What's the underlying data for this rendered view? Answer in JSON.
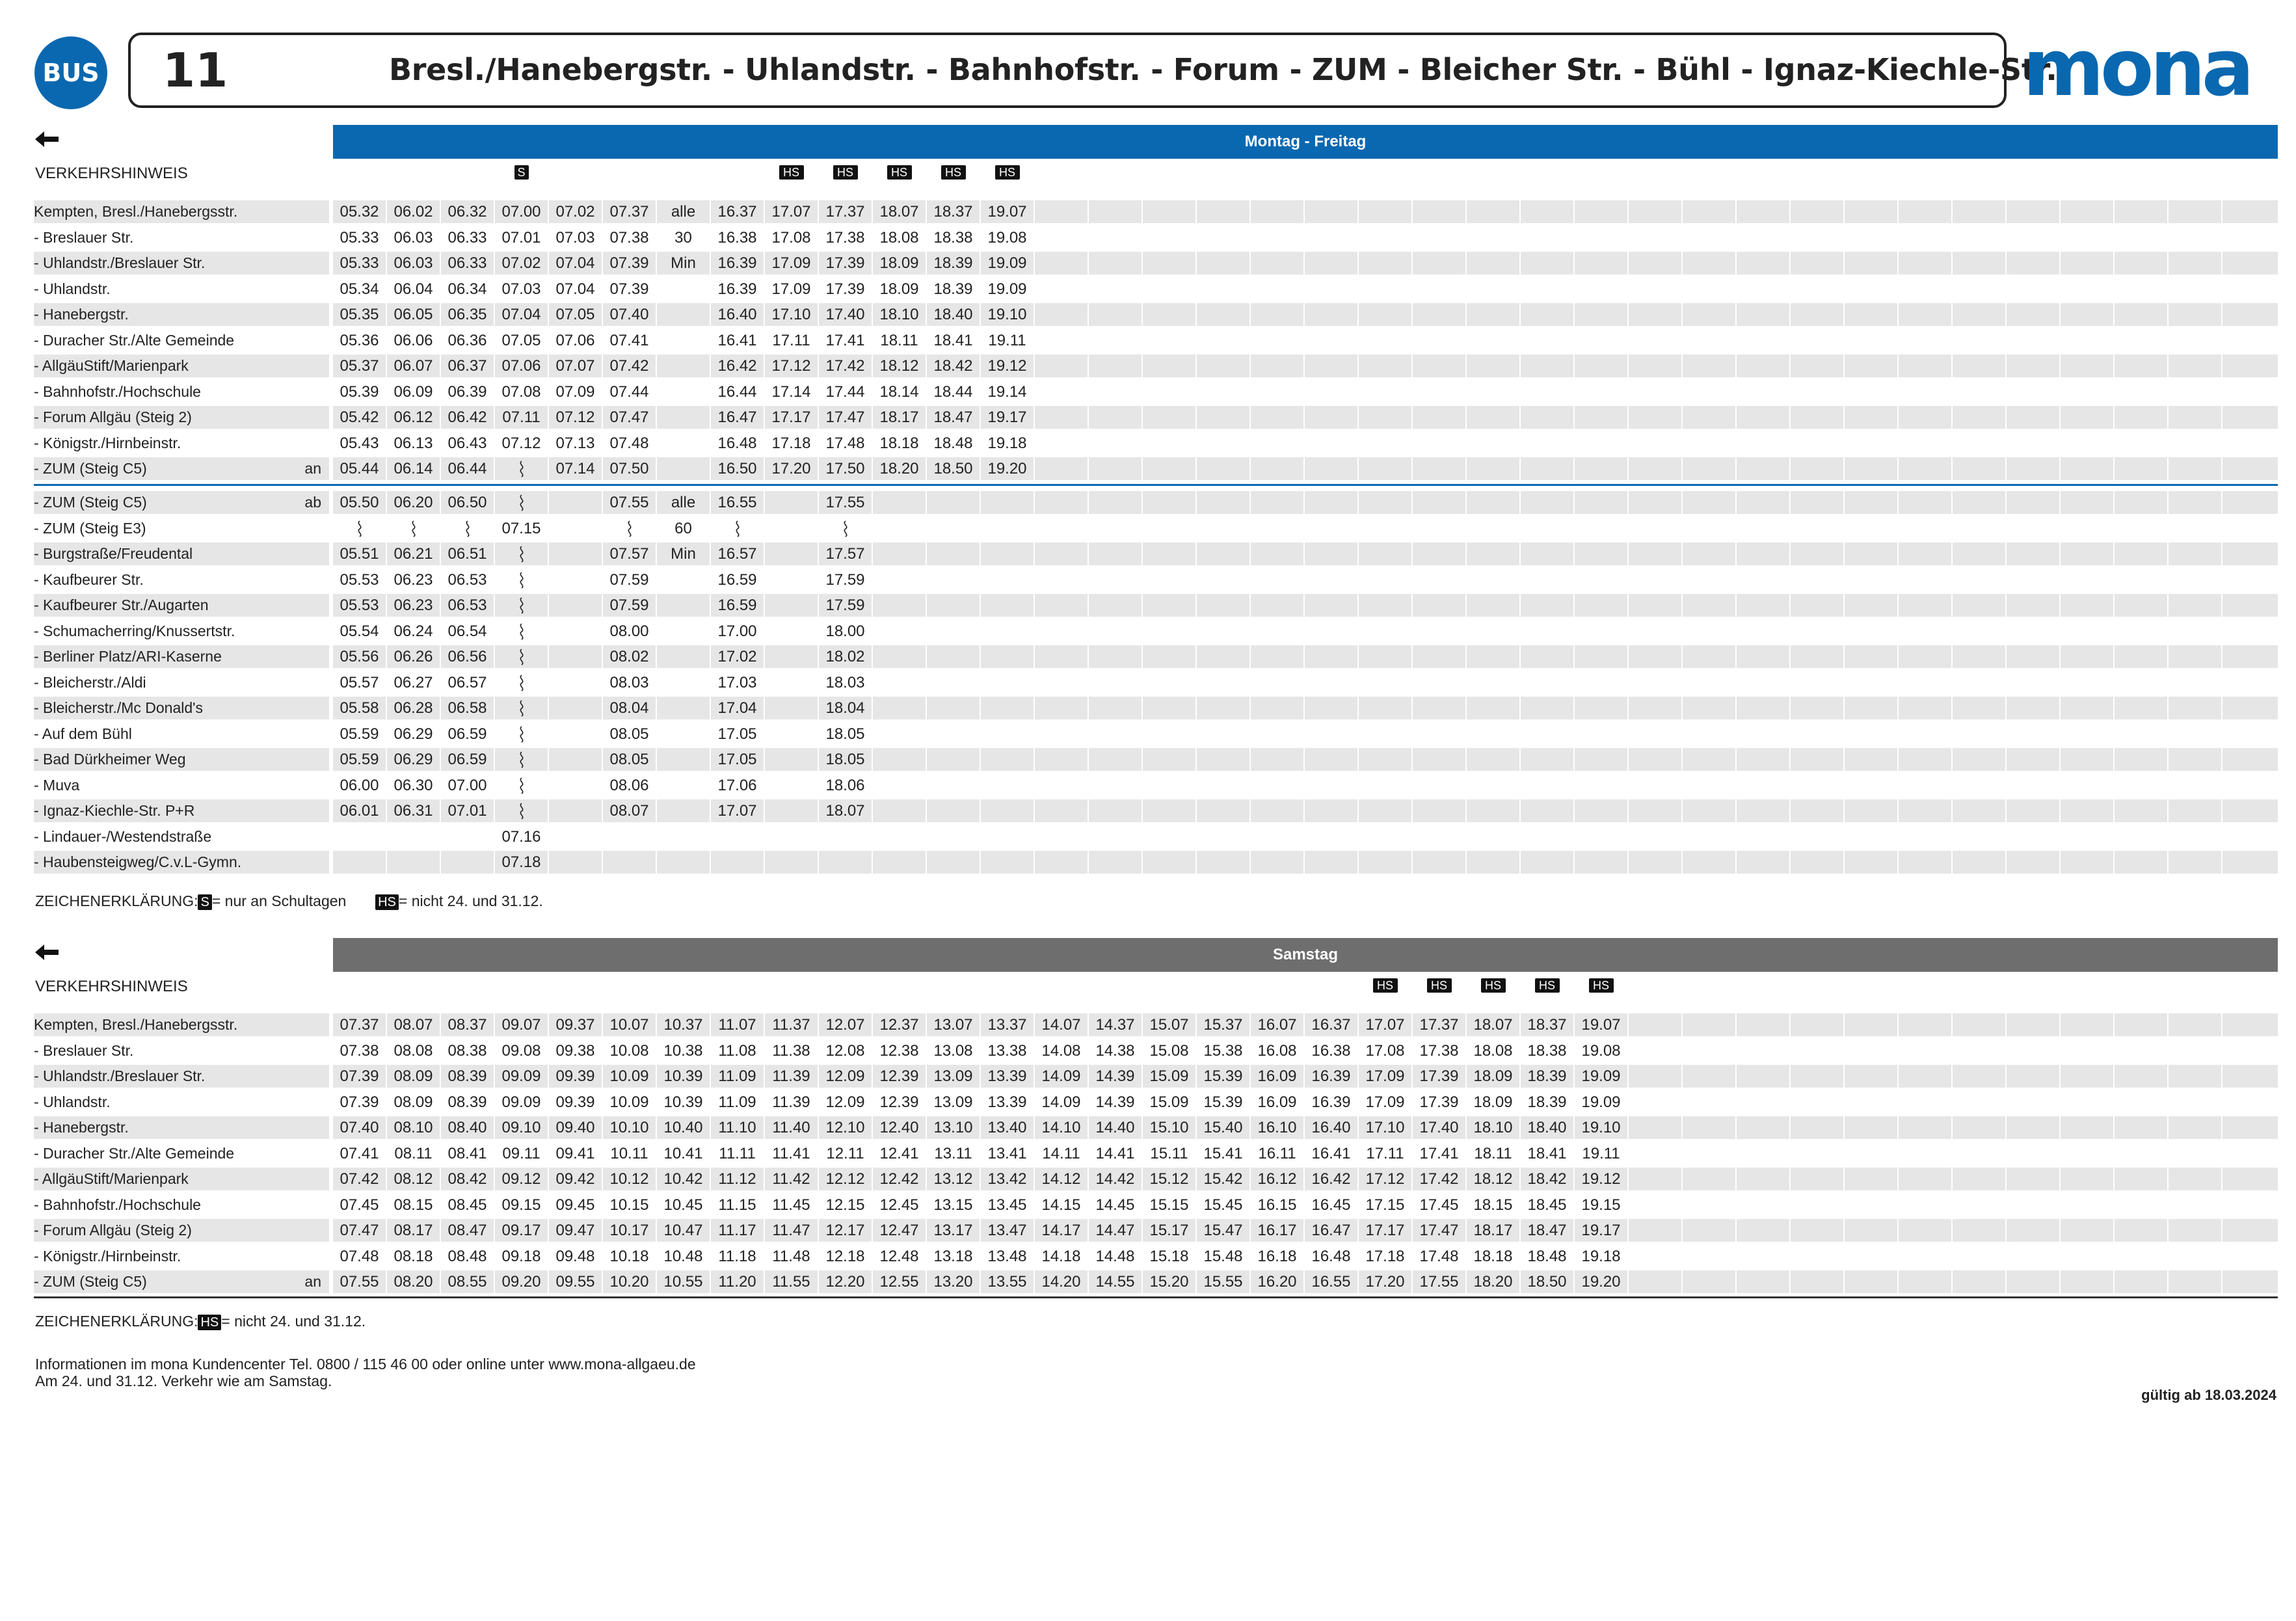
{
  "header": {
    "bus_label": "BUS",
    "line_number": "11",
    "route_title": "Bresl./Hanebergstr. - Uhlandstr. - Bahnhofstr. - Forum - ZUM - Bleicher Str. - Bühl  - Ignaz-Kiechle-Str.",
    "brand": "mona",
    "brand_color": "#0a68b0"
  },
  "weekday": {
    "day_label": "Montag - Freitag",
    "bar_color": "#0a68b0",
    "hinweis_label": "VERKEHRSHINWEIS",
    "markers": [
      "",
      "",
      "",
      "S",
      "",
      "",
      "",
      "",
      "HS",
      "HS",
      "HS",
      "HS",
      "HS"
    ],
    "part1": {
      "stops": [
        {
          "name": "Kempten, Bresl./Hanebergsstr.",
          "times": [
            "05.32",
            "06.02",
            "06.32",
            "07.00",
            "07.02",
            "07.37",
            "alle",
            "16.37",
            "17.07",
            "17.37",
            "18.07",
            "18.37",
            "19.07"
          ]
        },
        {
          "name": "- Breslauer Str.",
          "times": [
            "05.33",
            "06.03",
            "06.33",
            "07.01",
            "07.03",
            "07.38",
            "30",
            "16.38",
            "17.08",
            "17.38",
            "18.08",
            "18.38",
            "19.08"
          ]
        },
        {
          "name": "- Uhlandstr./Breslauer Str.",
          "times": [
            "05.33",
            "06.03",
            "06.33",
            "07.02",
            "07.04",
            "07.39",
            "Min",
            "16.39",
            "17.09",
            "17.39",
            "18.09",
            "18.39",
            "19.09"
          ]
        },
        {
          "name": "- Uhlandstr.",
          "times": [
            "05.34",
            "06.04",
            "06.34",
            "07.03",
            "07.04",
            "07.39",
            "",
            "16.39",
            "17.09",
            "17.39",
            "18.09",
            "18.39",
            "19.09"
          ]
        },
        {
          "name": "- Hanebergstr.",
          "times": [
            "05.35",
            "06.05",
            "06.35",
            "07.04",
            "07.05",
            "07.40",
            "",
            "16.40",
            "17.10",
            "17.40",
            "18.10",
            "18.40",
            "19.10"
          ]
        },
        {
          "name": "- Duracher Str./Alte Gemeinde",
          "times": [
            "05.36",
            "06.06",
            "06.36",
            "07.05",
            "07.06",
            "07.41",
            "",
            "16.41",
            "17.11",
            "17.41",
            "18.11",
            "18.41",
            "19.11"
          ]
        },
        {
          "name": "- AllgäuStift/Marienpark",
          "times": [
            "05.37",
            "06.07",
            "06.37",
            "07.06",
            "07.07",
            "07.42",
            "",
            "16.42",
            "17.12",
            "17.42",
            "18.12",
            "18.42",
            "19.12"
          ]
        },
        {
          "name": "- Bahnhofstr./Hochschule",
          "times": [
            "05.39",
            "06.09",
            "06.39",
            "07.08",
            "07.09",
            "07.44",
            "",
            "16.44",
            "17.14",
            "17.44",
            "18.14",
            "18.44",
            "19.14"
          ]
        },
        {
          "name": "- Forum Allgäu (Steig 2)",
          "times": [
            "05.42",
            "06.12",
            "06.42",
            "07.11",
            "07.12",
            "07.47",
            "",
            "16.47",
            "17.17",
            "17.47",
            "18.17",
            "18.47",
            "19.17"
          ]
        },
        {
          "name": "- Königstr./Hirnbeinstr.",
          "times": [
            "05.43",
            "06.13",
            "06.43",
            "07.12",
            "07.13",
            "07.48",
            "",
            "16.48",
            "17.18",
            "17.48",
            "18.18",
            "18.48",
            "19.18"
          ]
        },
        {
          "name": "- ZUM (Steig C5)",
          "anab": "an",
          "times": [
            "05.44",
            "06.14",
            "06.44",
            "~",
            "07.14",
            "07.50",
            "",
            "16.50",
            "17.20",
            "17.50",
            "18.20",
            "18.50",
            "19.20"
          ]
        }
      ]
    },
    "part2": {
      "stops": [
        {
          "name": "- ZUM (Steig C5)",
          "anab": "ab",
          "times": [
            "05.50",
            "06.20",
            "06.50",
            "~",
            "",
            "07.55",
            "alle",
            "16.55",
            "",
            "17.55"
          ]
        },
        {
          "name": "- ZUM (Steig E3)",
          "times": [
            "~",
            "~",
            "~",
            "07.15",
            "",
            "~",
            "60",
            "~",
            "",
            "~"
          ]
        },
        {
          "name": "- Burgstraße/Freudental",
          "times": [
            "05.51",
            "06.21",
            "06.51",
            "~",
            "",
            "07.57",
            "Min",
            "16.57",
            "",
            "17.57"
          ]
        },
        {
          "name": "- Kaufbeurer Str.",
          "times": [
            "05.53",
            "06.23",
            "06.53",
            "~",
            "",
            "07.59",
            "",
            "16.59",
            "",
            "17.59"
          ]
        },
        {
          "name": "- Kaufbeurer Str./Augarten",
          "times": [
            "05.53",
            "06.23",
            "06.53",
            "~",
            "",
            "07.59",
            "",
            "16.59",
            "",
            "17.59"
          ]
        },
        {
          "name": "- Schumacherring/Knussertstr.",
          "times": [
            "05.54",
            "06.24",
            "06.54",
            "~",
            "",
            "08.00",
            "",
            "17.00",
            "",
            "18.00"
          ]
        },
        {
          "name": "- Berliner Platz/ARI-Kaserne",
          "times": [
            "05.56",
            "06.26",
            "06.56",
            "~",
            "",
            "08.02",
            "",
            "17.02",
            "",
            "18.02"
          ]
        },
        {
          "name": "- Bleicherstr./Aldi",
          "times": [
            "05.57",
            "06.27",
            "06.57",
            "~",
            "",
            "08.03",
            "",
            "17.03",
            "",
            "18.03"
          ]
        },
        {
          "name": "- Bleicherstr./Mc Donald's",
          "times": [
            "05.58",
            "06.28",
            "06.58",
            "~",
            "",
            "08.04",
            "",
            "17.04",
            "",
            "18.04"
          ]
        },
        {
          "name": "- Auf dem Bühl",
          "times": [
            "05.59",
            "06.29",
            "06.59",
            "~",
            "",
            "08.05",
            "",
            "17.05",
            "",
            "18.05"
          ]
        },
        {
          "name": "- Bad Dürkheimer Weg",
          "times": [
            "05.59",
            "06.29",
            "06.59",
            "~",
            "",
            "08.05",
            "",
            "17.05",
            "",
            "18.05"
          ]
        },
        {
          "name": "- Muva",
          "times": [
            "06.00",
            "06.30",
            "07.00",
            "~",
            "",
            "08.06",
            "",
            "17.06",
            "",
            "18.06"
          ]
        },
        {
          "name": "- Ignaz-Kiechle-Str. P+R",
          "times": [
            "06.01",
            "06.31",
            "07.01",
            "~",
            "",
            "08.07",
            "",
            "17.07",
            "",
            "18.07"
          ]
        },
        {
          "name": "- Lindauer-/Westendstraße",
          "times": [
            "",
            "",
            "",
            "07.16"
          ]
        },
        {
          "name": "- Haubensteigweg/C.v.L-Gymn.",
          "times": [
            "",
            "",
            "",
            "07.18"
          ]
        }
      ]
    },
    "legend": {
      "prefix": "ZEICHENERKLÄRUNG:",
      "s_tag": "S",
      "s_text": "= nur an Schultagen",
      "hs_tag": "HS",
      "hs_text": "= nicht 24. und 31.12."
    }
  },
  "saturday": {
    "day_label": "Samstag",
    "bar_color": "#6e6e6e",
    "hinweis_label": "VERKEHRSHINWEIS",
    "markers": [
      "",
      "",
      "",
      "",
      "",
      "",
      "",
      "",
      "",
      "",
      "",
      "",
      "",
      "",
      "",
      "",
      "",
      "",
      "",
      "HS",
      "HS",
      "HS",
      "HS",
      "HS"
    ],
    "stops": [
      {
        "name": "Kempten, Bresl./Hanebergsstr.",
        "times": [
          "07.37",
          "08.07",
          "08.37",
          "09.07",
          "09.37",
          "10.07",
          "10.37",
          "11.07",
          "11.37",
          "12.07",
          "12.37",
          "13.07",
          "13.37",
          "14.07",
          "14.37",
          "15.07",
          "15.37",
          "16.07",
          "16.37",
          "17.07",
          "17.37",
          "18.07",
          "18.37",
          "19.07"
        ]
      },
      {
        "name": "- Breslauer Str.",
        "times": [
          "07.38",
          "08.08",
          "08.38",
          "09.08",
          "09.38",
          "10.08",
          "10.38",
          "11.08",
          "11.38",
          "12.08",
          "12.38",
          "13.08",
          "13.38",
          "14.08",
          "14.38",
          "15.08",
          "15.38",
          "16.08",
          "16.38",
          "17.08",
          "17.38",
          "18.08",
          "18.38",
          "19.08"
        ]
      },
      {
        "name": "- Uhlandstr./Breslauer Str.",
        "times": [
          "07.39",
          "08.09",
          "08.39",
          "09.09",
          "09.39",
          "10.09",
          "10.39",
          "11.09",
          "11.39",
          "12.09",
          "12.39",
          "13.09",
          "13.39",
          "14.09",
          "14.39",
          "15.09",
          "15.39",
          "16.09",
          "16.39",
          "17.09",
          "17.39",
          "18.09",
          "18.39",
          "19.09"
        ]
      },
      {
        "name": "- Uhlandstr.",
        "times": [
          "07.39",
          "08.09",
          "08.39",
          "09.09",
          "09.39",
          "10.09",
          "10.39",
          "11.09",
          "11.39",
          "12.09",
          "12.39",
          "13.09",
          "13.39",
          "14.09",
          "14.39",
          "15.09",
          "15.39",
          "16.09",
          "16.39",
          "17.09",
          "17.39",
          "18.09",
          "18.39",
          "19.09"
        ]
      },
      {
        "name": "- Hanebergstr.",
        "times": [
          "07.40",
          "08.10",
          "08.40",
          "09.10",
          "09.40",
          "10.10",
          "10.40",
          "11.10",
          "11.40",
          "12.10",
          "12.40",
          "13.10",
          "13.40",
          "14.10",
          "14.40",
          "15.10",
          "15.40",
          "16.10",
          "16.40",
          "17.10",
          "17.40",
          "18.10",
          "18.40",
          "19.10"
        ]
      },
      {
        "name": "- Duracher Str./Alte Gemeinde",
        "times": [
          "07.41",
          "08.11",
          "08.41",
          "09.11",
          "09.41",
          "10.11",
          "10.41",
          "11.11",
          "11.41",
          "12.11",
          "12.41",
          "13.11",
          "13.41",
          "14.11",
          "14.41",
          "15.11",
          "15.41",
          "16.11",
          "16.41",
          "17.11",
          "17.41",
          "18.11",
          "18.41",
          "19.11"
        ]
      },
      {
        "name": "- AllgäuStift/Marienpark",
        "times": [
          "07.42",
          "08.12",
          "08.42",
          "09.12",
          "09.42",
          "10.12",
          "10.42",
          "11.12",
          "11.42",
          "12.12",
          "12.42",
          "13.12",
          "13.42",
          "14.12",
          "14.42",
          "15.12",
          "15.42",
          "16.12",
          "16.42",
          "17.12",
          "17.42",
          "18.12",
          "18.42",
          "19.12"
        ]
      },
      {
        "name": "- Bahnhofstr./Hochschule",
        "times": [
          "07.45",
          "08.15",
          "08.45",
          "09.15",
          "09.45",
          "10.15",
          "10.45",
          "11.15",
          "11.45",
          "12.15",
          "12.45",
          "13.15",
          "13.45",
          "14.15",
          "14.45",
          "15.15",
          "15.45",
          "16.15",
          "16.45",
          "17.15",
          "17.45",
          "18.15",
          "18.45",
          "19.15"
        ]
      },
      {
        "name": "- Forum Allgäu (Steig 2)",
        "times": [
          "07.47",
          "08.17",
          "08.47",
          "09.17",
          "09.47",
          "10.17",
          "10.47",
          "11.17",
          "11.47",
          "12.17",
          "12.47",
          "13.17",
          "13.47",
          "14.17",
          "14.47",
          "15.17",
          "15.47",
          "16.17",
          "16.47",
          "17.17",
          "17.47",
          "18.17",
          "18.47",
          "19.17"
        ]
      },
      {
        "name": "- Königstr./Hirnbeinstr.",
        "times": [
          "07.48",
          "08.18",
          "08.48",
          "09.18",
          "09.48",
          "10.18",
          "10.48",
          "11.18",
          "11.48",
          "12.18",
          "12.48",
          "13.18",
          "13.48",
          "14.18",
          "14.48",
          "15.18",
          "15.48",
          "16.18",
          "16.48",
          "17.18",
          "17.48",
          "18.18",
          "18.48",
          "19.18"
        ]
      },
      {
        "name": "- ZUM (Steig C5)",
        "anab": "an",
        "times": [
          "07.55",
          "08.20",
          "08.55",
          "09.20",
          "09.55",
          "10.20",
          "10.55",
          "11.20",
          "11.55",
          "12.20",
          "12.55",
          "13.20",
          "13.55",
          "14.20",
          "14.55",
          "15.20",
          "15.55",
          "16.20",
          "16.55",
          "17.20",
          "17.55",
          "18.20",
          "18.50",
          "19.20"
        ]
      }
    ],
    "legend": {
      "prefix": "ZEICHENERKLÄRUNG:",
      "hs_tag": "HS",
      "hs_text": "= nicht 24. und 31.12."
    }
  },
  "footer": {
    "info_line1": "Informationen im mona Kundencenter Tel. 0800 / 115 46 00 oder online unter www.mona-allgaeu.de",
    "info_line2": "Am 24. und 31.12. Verkehr wie am Samstag.",
    "valid_from": "gültig ab 18.03.2024"
  }
}
